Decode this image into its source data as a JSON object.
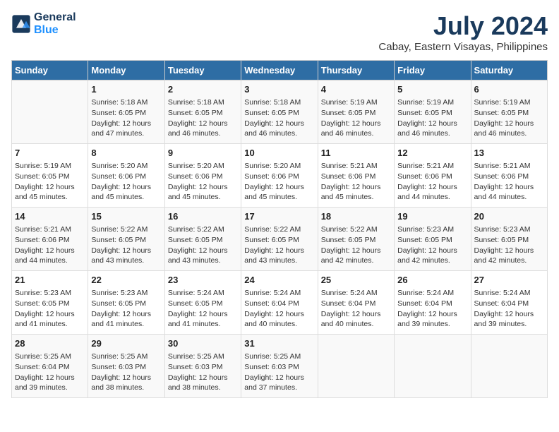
{
  "header": {
    "logo_line1": "General",
    "logo_line2": "Blue",
    "title": "July 2024",
    "subtitle": "Cabay, Eastern Visayas, Philippines"
  },
  "calendar": {
    "days_of_week": [
      "Sunday",
      "Monday",
      "Tuesday",
      "Wednesday",
      "Thursday",
      "Friday",
      "Saturday"
    ],
    "weeks": [
      [
        {
          "day": "",
          "info": ""
        },
        {
          "day": "1",
          "info": "Sunrise: 5:18 AM\nSunset: 6:05 PM\nDaylight: 12 hours\nand 47 minutes."
        },
        {
          "day": "2",
          "info": "Sunrise: 5:18 AM\nSunset: 6:05 PM\nDaylight: 12 hours\nand 46 minutes."
        },
        {
          "day": "3",
          "info": "Sunrise: 5:18 AM\nSunset: 6:05 PM\nDaylight: 12 hours\nand 46 minutes."
        },
        {
          "day": "4",
          "info": "Sunrise: 5:19 AM\nSunset: 6:05 PM\nDaylight: 12 hours\nand 46 minutes."
        },
        {
          "day": "5",
          "info": "Sunrise: 5:19 AM\nSunset: 6:05 PM\nDaylight: 12 hours\nand 46 minutes."
        },
        {
          "day": "6",
          "info": "Sunrise: 5:19 AM\nSunset: 6:05 PM\nDaylight: 12 hours\nand 46 minutes."
        }
      ],
      [
        {
          "day": "7",
          "info": "Sunrise: 5:19 AM\nSunset: 6:05 PM\nDaylight: 12 hours\nand 45 minutes."
        },
        {
          "day": "8",
          "info": "Sunrise: 5:20 AM\nSunset: 6:06 PM\nDaylight: 12 hours\nand 45 minutes."
        },
        {
          "day": "9",
          "info": "Sunrise: 5:20 AM\nSunset: 6:06 PM\nDaylight: 12 hours\nand 45 minutes."
        },
        {
          "day": "10",
          "info": "Sunrise: 5:20 AM\nSunset: 6:06 PM\nDaylight: 12 hours\nand 45 minutes."
        },
        {
          "day": "11",
          "info": "Sunrise: 5:21 AM\nSunset: 6:06 PM\nDaylight: 12 hours\nand 45 minutes."
        },
        {
          "day": "12",
          "info": "Sunrise: 5:21 AM\nSunset: 6:06 PM\nDaylight: 12 hours\nand 44 minutes."
        },
        {
          "day": "13",
          "info": "Sunrise: 5:21 AM\nSunset: 6:06 PM\nDaylight: 12 hours\nand 44 minutes."
        }
      ],
      [
        {
          "day": "14",
          "info": "Sunrise: 5:21 AM\nSunset: 6:06 PM\nDaylight: 12 hours\nand 44 minutes."
        },
        {
          "day": "15",
          "info": "Sunrise: 5:22 AM\nSunset: 6:05 PM\nDaylight: 12 hours\nand 43 minutes."
        },
        {
          "day": "16",
          "info": "Sunrise: 5:22 AM\nSunset: 6:05 PM\nDaylight: 12 hours\nand 43 minutes."
        },
        {
          "day": "17",
          "info": "Sunrise: 5:22 AM\nSunset: 6:05 PM\nDaylight: 12 hours\nand 43 minutes."
        },
        {
          "day": "18",
          "info": "Sunrise: 5:22 AM\nSunset: 6:05 PM\nDaylight: 12 hours\nand 42 minutes."
        },
        {
          "day": "19",
          "info": "Sunrise: 5:23 AM\nSunset: 6:05 PM\nDaylight: 12 hours\nand 42 minutes."
        },
        {
          "day": "20",
          "info": "Sunrise: 5:23 AM\nSunset: 6:05 PM\nDaylight: 12 hours\nand 42 minutes."
        }
      ],
      [
        {
          "day": "21",
          "info": "Sunrise: 5:23 AM\nSunset: 6:05 PM\nDaylight: 12 hours\nand 41 minutes."
        },
        {
          "day": "22",
          "info": "Sunrise: 5:23 AM\nSunset: 6:05 PM\nDaylight: 12 hours\nand 41 minutes."
        },
        {
          "day": "23",
          "info": "Sunrise: 5:24 AM\nSunset: 6:05 PM\nDaylight: 12 hours\nand 41 minutes."
        },
        {
          "day": "24",
          "info": "Sunrise: 5:24 AM\nSunset: 6:04 PM\nDaylight: 12 hours\nand 40 minutes."
        },
        {
          "day": "25",
          "info": "Sunrise: 5:24 AM\nSunset: 6:04 PM\nDaylight: 12 hours\nand 40 minutes."
        },
        {
          "day": "26",
          "info": "Sunrise: 5:24 AM\nSunset: 6:04 PM\nDaylight: 12 hours\nand 39 minutes."
        },
        {
          "day": "27",
          "info": "Sunrise: 5:24 AM\nSunset: 6:04 PM\nDaylight: 12 hours\nand 39 minutes."
        }
      ],
      [
        {
          "day": "28",
          "info": "Sunrise: 5:25 AM\nSunset: 6:04 PM\nDaylight: 12 hours\nand 39 minutes."
        },
        {
          "day": "29",
          "info": "Sunrise: 5:25 AM\nSunset: 6:03 PM\nDaylight: 12 hours\nand 38 minutes."
        },
        {
          "day": "30",
          "info": "Sunrise: 5:25 AM\nSunset: 6:03 PM\nDaylight: 12 hours\nand 38 minutes."
        },
        {
          "day": "31",
          "info": "Sunrise: 5:25 AM\nSunset: 6:03 PM\nDaylight: 12 hours\nand 37 minutes."
        },
        {
          "day": "",
          "info": ""
        },
        {
          "day": "",
          "info": ""
        },
        {
          "day": "",
          "info": ""
        }
      ]
    ]
  }
}
